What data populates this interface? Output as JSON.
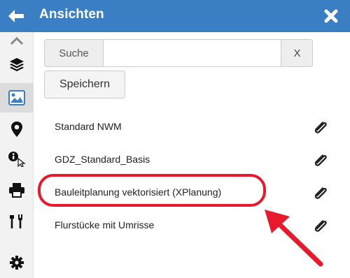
{
  "header": {
    "title": "Ansichten",
    "back_icon": "arrow-left-icon",
    "close_icon": "close-x-icon",
    "color": "#3a7fc4"
  },
  "sidebar": {
    "items": [
      {
        "icon": "chevron-up-icon"
      },
      {
        "icon": "layers-icon"
      },
      {
        "icon": "image-icon",
        "active": true
      },
      {
        "icon": "map-marker-icon"
      },
      {
        "icon": "info-cursor-icon"
      },
      {
        "icon": "print-icon"
      },
      {
        "icon": "tools-icon"
      },
      {
        "icon": "gear-icon"
      }
    ]
  },
  "search": {
    "label": "Suche",
    "value": "",
    "placeholder": "",
    "clear_label": "X"
  },
  "save_button": {
    "label": "Speichern"
  },
  "views": [
    {
      "label": "Standard NWM",
      "icon": "paperclip-icon"
    },
    {
      "label": "GDZ_Standard_Basis",
      "icon": "paperclip-icon"
    },
    {
      "label": "Bauleitplanung vektorisiert (XPlanung)",
      "icon": "paperclip-icon",
      "highlighted": true
    },
    {
      "label": "Flurstücke mit Umrisse",
      "icon": "paperclip-icon"
    }
  ],
  "annotation": {
    "color": "#e8192c"
  }
}
